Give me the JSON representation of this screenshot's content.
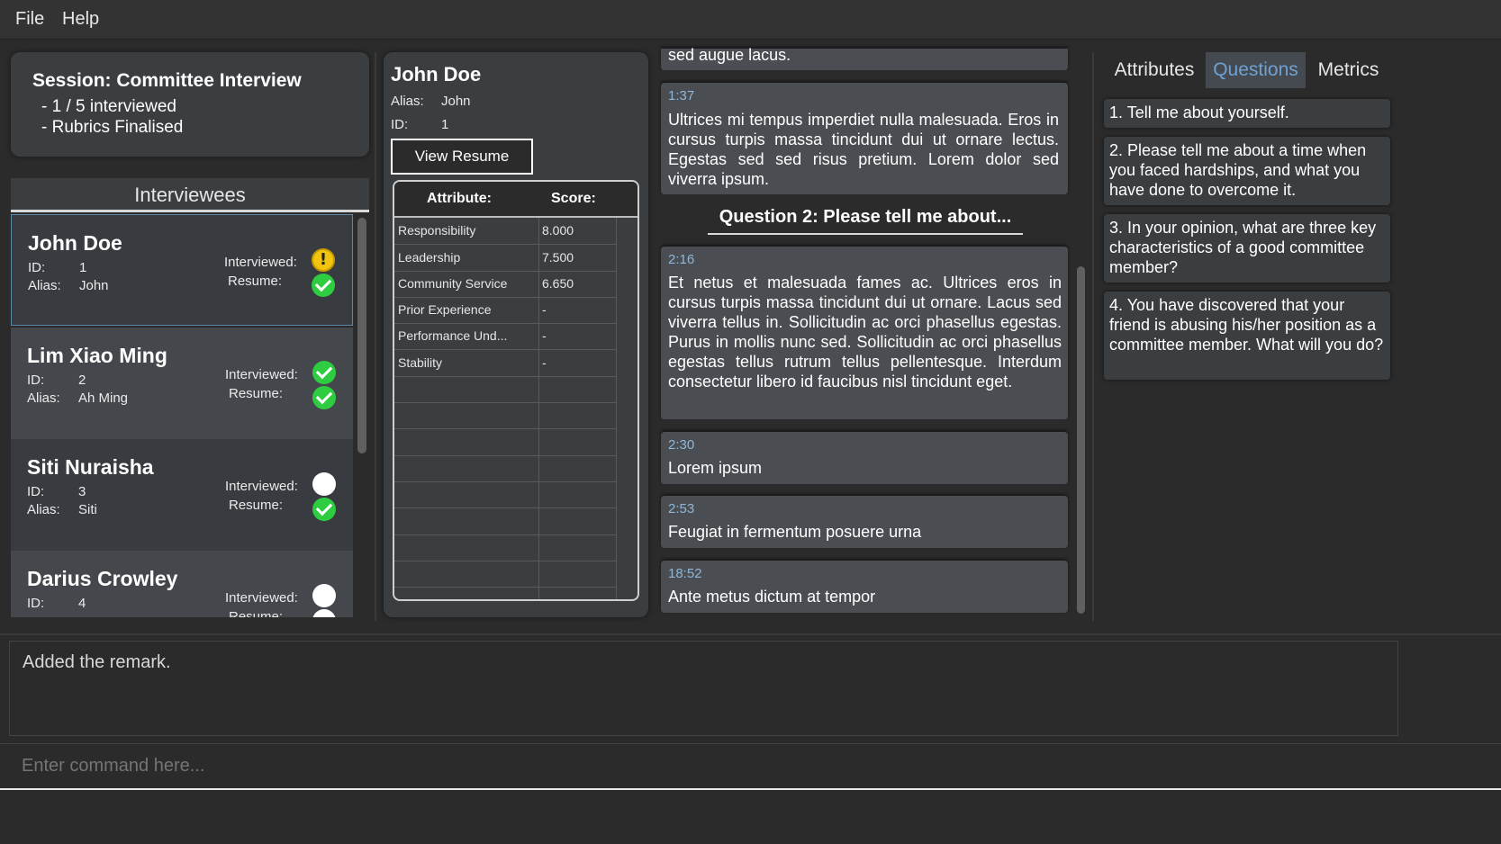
{
  "menu": [
    "File",
    "Help"
  ],
  "session": {
    "title": "Session: Committee Interview",
    "lines": [
      "- 1 / 5 interviewed",
      "- Rubrics Finalised"
    ]
  },
  "interviewees_header": "Interviewees",
  "labels": {
    "interviewed": "Interviewed:",
    "resume": "Resume:",
    "id": "ID:",
    "alias": "Alias:"
  },
  "interviewees": [
    {
      "name": "John Doe",
      "id": "1",
      "alias": "John",
      "interviewed_status": "warning",
      "resume_status": "done"
    },
    {
      "name": "Lim Xiao Ming",
      "id": "2",
      "alias": "Ah Ming",
      "interviewed_status": "done",
      "resume_status": "done"
    },
    {
      "name": "Siti Nuraisha",
      "id": "3",
      "alias": "Siti",
      "interviewed_status": "none",
      "resume_status": "done"
    },
    {
      "name": "Darius Crowley",
      "id": "4",
      "alias": "",
      "interviewed_status": "none",
      "resume_status": "none"
    }
  ],
  "detail": {
    "name": "John Doe",
    "alias_label": "Alias:",
    "alias": "John",
    "id_label": "ID:",
    "id": "1",
    "view_resume": "View Resume",
    "table_headers": [
      "Attribute:",
      "Score:"
    ],
    "rows": [
      {
        "attribute": "Responsibility",
        "score": "8.000"
      },
      {
        "attribute": "Leadership",
        "score": "7.500"
      },
      {
        "attribute": "Community Service",
        "score": "6.650"
      },
      {
        "attribute": "Prior Experience",
        "score": "-"
      },
      {
        "attribute": "Performance Und...",
        "score": "-"
      },
      {
        "attribute": "Stability",
        "score": "-"
      }
    ]
  },
  "remarks": {
    "partial_text": "sed augue lacus.",
    "q1_remarks": [
      {
        "time": "1:37",
        "text": "Ultrices mi tempus imperdiet nulla malesuada. Eros in cursus turpis massa tincidunt dui ut ornare lectus. Egestas sed sed risus pretium. Lorem dolor sed viverra ipsum."
      }
    ],
    "question_heading": "Question 2: Please tell me about...",
    "q2_remarks": [
      {
        "time": "2:16",
        "text": "Et netus et malesuada fames ac. Ultrices eros in cursus turpis massa tincidunt dui ut ornare. Lacus sed viverra tellus in. Sollicitudin ac orci phasellus egestas. Purus in mollis nunc sed. Sollicitudin ac orci phasellus egestas tellus rutrum tellus pellentesque. Interdum consectetur libero id faucibus nisl tincidunt eget."
      },
      {
        "time": "2:30",
        "text": "Lorem ipsum"
      },
      {
        "time": "2:53",
        "text": "Feugiat in fermentum posuere urna"
      },
      {
        "time": "18:52",
        "text": "Ante metus dictum at tempor"
      }
    ]
  },
  "tabs": [
    {
      "label": "Attributes",
      "active": false
    },
    {
      "label": "Questions",
      "active": true
    },
    {
      "label": "Metrics",
      "active": false
    }
  ],
  "questions": [
    "1. Tell me about yourself.",
    "2. Please tell me about a time when you faced hardships, and what you have done to overcome it.",
    "3. In your opinion, what are three key characteristics of a good committee member?",
    "4. You have discovered that your friend is abusing his/her position as a committee member. What will you do?"
  ],
  "result_text": "Added the remark.",
  "command": {
    "placeholder": "Enter command here..."
  },
  "colors": {
    "accent": "#6ea1d4",
    "check": "#2ecc40",
    "warning": "#f1c40f",
    "time": "#8fb6d8"
  }
}
